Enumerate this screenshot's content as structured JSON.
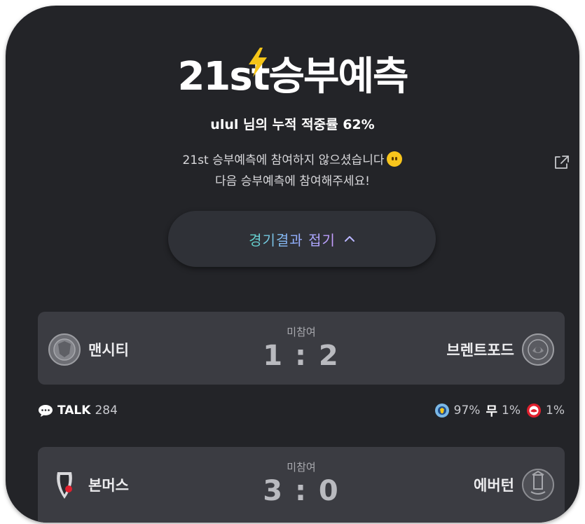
{
  "header": {
    "title_prefix": "21st",
    "title_main": "승부예측",
    "subtitle": "ulul 님의 누적 적중률 62%",
    "message_line1": "21st 승부예측에 참여하지 않으셨습니다",
    "message_line2": "다음 승부예측에 참여해주세요!"
  },
  "toggle": {
    "label": "경기결과 접기"
  },
  "matches": [
    {
      "status": "미참여",
      "score": "1 : 2",
      "home": {
        "name": "맨시티",
        "badge_icon": "man-city-badge-icon"
      },
      "away": {
        "name": "브렌트포드",
        "badge_icon": "brentford-badge-icon"
      }
    },
    {
      "status": "미참여",
      "score": "3 : 0",
      "home": {
        "name": "본머스",
        "badge_icon": "bournemouth-badge-icon"
      },
      "away": {
        "name": "에버턴",
        "badge_icon": "everton-badge-icon"
      }
    }
  ],
  "stats": {
    "talk_label": "TALK",
    "talk_count": "284",
    "home_pct": "97%",
    "draw_label": "무",
    "draw_pct": "1%",
    "away_pct": "1%"
  },
  "colors": {
    "background": "#232428",
    "card": "#3b3c42",
    "bolt": "#f5c518",
    "accent_gradient": [
      "#5fd6c6",
      "#8fb2ff",
      "#c99cff"
    ]
  }
}
